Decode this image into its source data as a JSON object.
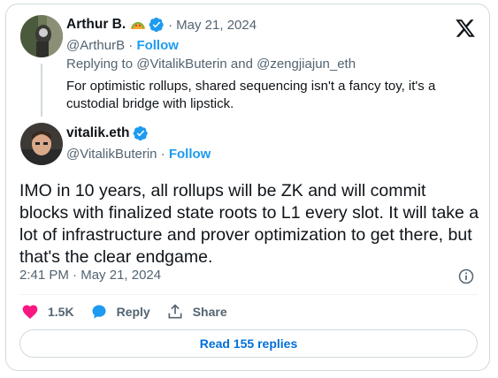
{
  "quoted_tweet": {
    "display_name": "Arthur B.",
    "emoji": "taco-icon",
    "date": "May 21, 2024",
    "handle": "@ArthurB",
    "follow_label": "Follow",
    "replying_prefix": "Replying to",
    "replying_to_1": "@VitalikButerin",
    "replying_and": "and",
    "replying_to_2": "@zengjiajun_eth",
    "text": "For optimistic rollups, shared sequencing isn't a fancy toy, it's a custodial bridge with lipstick."
  },
  "main_tweet": {
    "display_name": "vitalik.eth",
    "handle": "@VitalikButerin",
    "follow_label": "Follow",
    "text": "IMO in 10 years, all rollups will be ZK and will commit blocks with finalized state roots to L1 every slot.  It will take a lot of infrastructure and prover optimization to get there, but that's the clear endgame.",
    "time": "2:41 PM",
    "date": "May 21, 2024"
  },
  "actions": {
    "likes": "1.5K",
    "reply_label": "Reply",
    "share_label": "Share"
  },
  "read_replies_label": "Read 155 replies",
  "colors": {
    "accent": "#1d9bf0",
    "like": "#f91880",
    "verified": "#1d9bf0",
    "text_secondary": "#536471"
  }
}
